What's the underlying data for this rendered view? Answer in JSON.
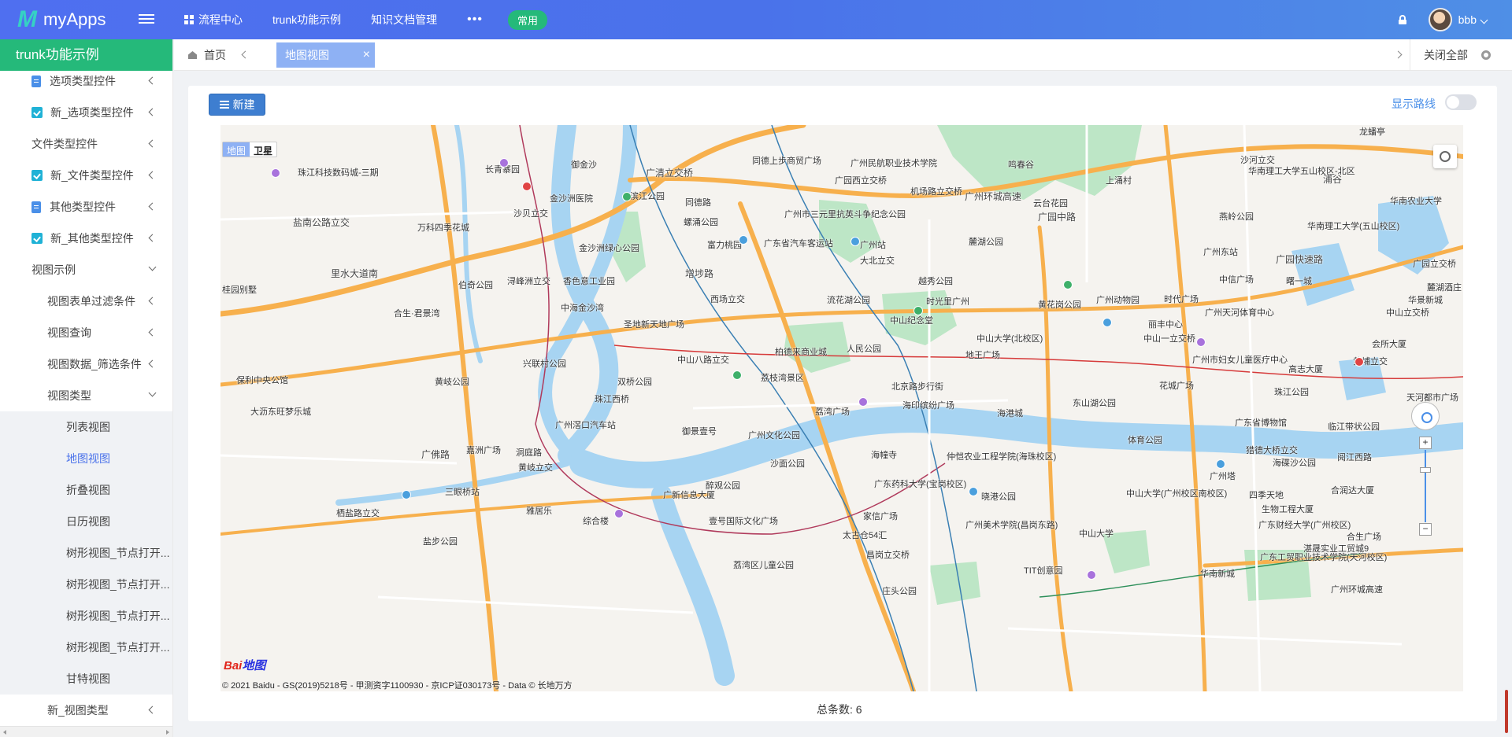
{
  "app": {
    "logo": "M",
    "name": "myApps"
  },
  "top_nav": {
    "items": [
      {
        "label": "流程中心"
      },
      {
        "label": "trunk功能示例"
      },
      {
        "label": "知识文档管理"
      }
    ],
    "more": "•••",
    "pill": "常用"
  },
  "user": {
    "name": "bbb"
  },
  "sidebar": {
    "title": "trunk功能示例",
    "items": [
      {
        "label": "选项类型控件",
        "icon": "doc-icon",
        "level": 1
      },
      {
        "label": "新_选项类型控件",
        "icon": "teal-check-icon",
        "level": 1
      },
      {
        "label": "文件类型控件",
        "level": 0
      },
      {
        "label": "新_文件类型控件",
        "icon": "teal-check-icon",
        "level": 1
      },
      {
        "label": "其他类型控件",
        "icon": "doc-icon",
        "level": 1
      },
      {
        "label": "新_其他类型控件",
        "icon": "teal-check-icon",
        "level": 1
      },
      {
        "label": "视图示例",
        "level": 0
      },
      {
        "label": "视图表单过滤条件",
        "level": 2
      },
      {
        "label": "视图查询",
        "level": 2
      },
      {
        "label": "视图数据_筛选条件",
        "level": 2
      },
      {
        "label": "视图类型",
        "level": 2
      },
      {
        "label": "列表视图",
        "level": 3
      },
      {
        "label": "地图视图",
        "level": 3,
        "active": true
      },
      {
        "label": "折叠视图",
        "level": 3
      },
      {
        "label": "日历视图",
        "level": 3
      },
      {
        "label": "树形视图_节点打开...",
        "level": 3
      },
      {
        "label": "树形视图_节点打开...",
        "level": 3
      },
      {
        "label": "树形视图_节点打开...",
        "level": 3
      },
      {
        "label": "树形视图_节点打开...",
        "level": 3
      },
      {
        "label": "甘特视图",
        "level": 3
      },
      {
        "label": "新_视图类型",
        "level": 2
      }
    ]
  },
  "tabs": {
    "home": "首页",
    "active": "地图视图",
    "close": "×",
    "close_all": "关闭全部"
  },
  "toolbar": {
    "new_label": "新建",
    "route_label": "显示路线"
  },
  "map": {
    "type_map": "地图",
    "type_satellite": "卫星",
    "logo_text": "Bai",
    "logo_suffix": "地图",
    "copyright": "© 2021 Baidu - GS(2019)5218号 - 甲测资字1100930 - 京ICP证030173号 - Data © 长地万方",
    "labels": [
      "珠江科技数码城-三期",
      "盐南公路立交",
      "万科四季花城",
      "沙贝立交",
      "金沙洲医院",
      "滨江公园",
      "御金沙",
      "长青寨园",
      "广清立交桥",
      "同德上步商贸广场",
      "广州民航职业技术学院",
      "广园西立交桥",
      "机场路立交桥",
      "广州环城高速",
      "云台花园",
      "广园中路",
      "麓湖公园",
      "广州市三元里抗英斗争纪念公园",
      "广州站",
      "广东省汽车客运站",
      "富力桃园",
      "螺涌公园",
      "同德路",
      "金沙洲绿心公园",
      "浔峰洲立交",
      "香色意工业园",
      "伯奇公园",
      "增埗路",
      "里水大道南",
      "桂园别墅",
      "合生·君景湾",
      "中海金沙湾",
      "西场立交",
      "大北立交",
      "越秀公园",
      "流花湖公园",
      "时光里广州",
      "黄花岗公园",
      "广州动物园",
      "中山纪念堂",
      "圣地新天地广场",
      "柏德来商业城",
      "人民公园",
      "中山大学(北校区)",
      "中山一立交桥",
      "丽丰中心",
      "地王广场",
      "中山八路立交",
      "兴联村公园",
      "荔枝湾景区",
      "北京路步行街",
      "保利中央公馆",
      "黄岐公园",
      "双桥公园",
      "珠江西桥",
      "广州滘口汽车站",
      "荔湾广场",
      "海印缤纷广场",
      "海港城",
      "东山湖公园",
      "大沥东旺梦乐城",
      "广州文化公园",
      "御景壹号",
      "嘉洲广场",
      "洞庭路",
      "广佛路",
      "黄岐立交",
      "海幢寺",
      "仲恺农业工程学院(海珠校区)",
      "沙面公园",
      "醉观公园",
      "广东药科大学(宝岗校区)",
      "晓港公园",
      "三眼桥站",
      "雅居乐",
      "综合楼",
      "广新信息大厦",
      "壹号国际文化广场",
      "太古仓54汇",
      "家信广场",
      "广州美术学院(昌岗东路)",
      "中山大学",
      "盐步公园",
      "栖盐路立交",
      "荔湾区儿童公园",
      "昌岗立交桥",
      "TIT创意园",
      "庄头公园",
      "沙河立交",
      "华南理工大学五山校区-北区",
      "华南农业大学",
      "华南理工大学(五山校区)",
      "燕岭公园",
      "广州东站",
      "中信广场",
      "时代广场",
      "广州天河体育中心",
      "广园快速路",
      "广园立交桥",
      "曙一城",
      "华景新城",
      "中山立交桥",
      "会所大厦",
      "黄埔立交",
      "广州市妇女儿童医疗中心",
      "高志大厦",
      "珠江公园",
      "天河都市广场",
      "广东省博物馆",
      "临江带状公园",
      "花城广场",
      "体育公园",
      "猎德大桥立交",
      "阅江西路",
      "广州塔",
      "海碟沙公园",
      "四季天地",
      "合润达大厦",
      "中山大学(广州校区南校区)",
      "生物工程大厦",
      "广东财经大学(广州校区)",
      "湛晟实业工贸城9",
      "合生广场",
      "广东工贸职业技术学院(天河校区)",
      "广州环城高速",
      "华南新城",
      "龙蟠亭",
      "浦谷",
      "麓湖酒庄",
      "鸣春谷",
      "上涌村"
    ]
  },
  "footer": {
    "total_label": "总条数:",
    "total_value": "6"
  },
  "colors": {
    "topbar": "#4f72ee",
    "accent_green": "#25b97a",
    "primary_blue": "#3e7ed0",
    "tab_active": "#8eb1f4",
    "river": "#a7d4f2",
    "park": "#bde6c6",
    "highway": "#f7b04d"
  }
}
